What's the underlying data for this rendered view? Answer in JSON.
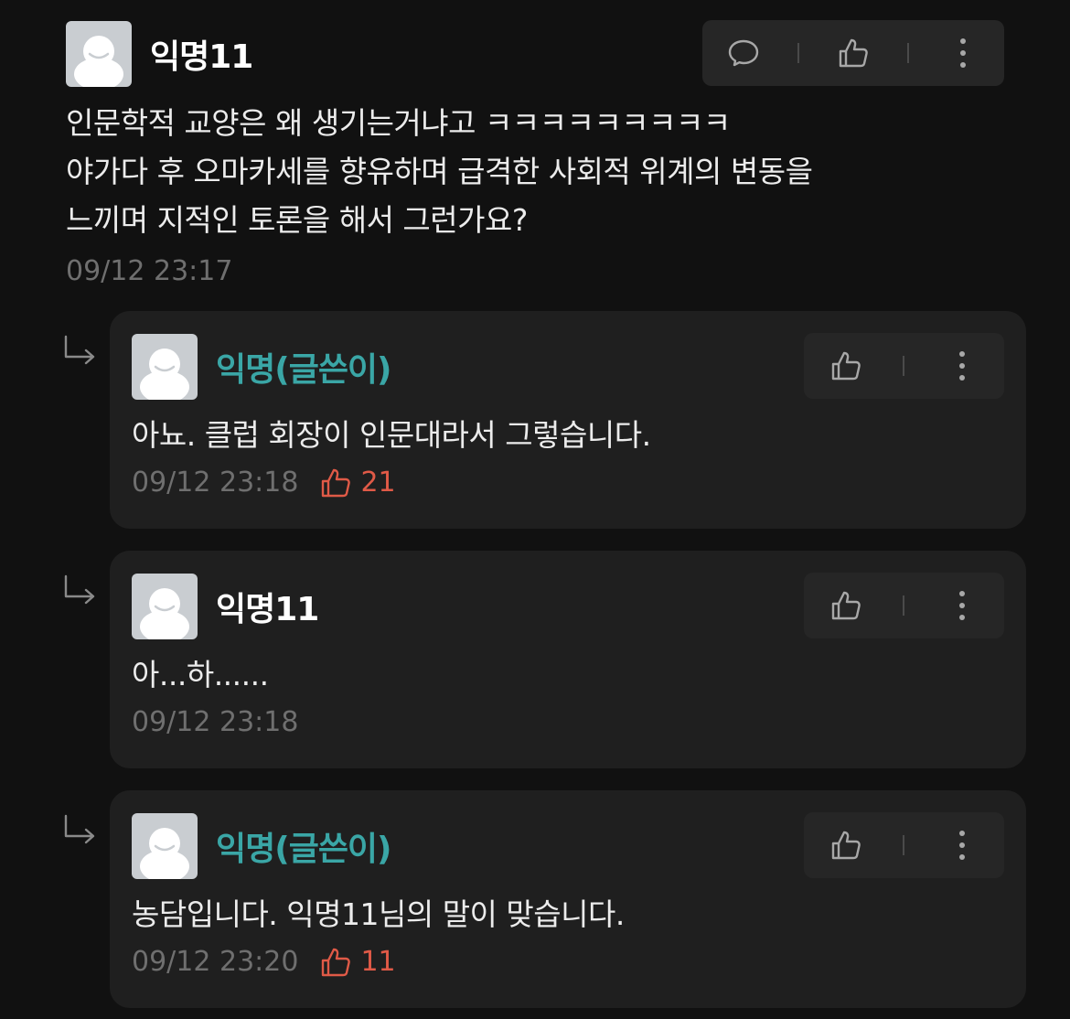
{
  "main": {
    "username": "익명11",
    "lines": [
      "인문학적 교양은 왜 생기는거냐고 ㅋㅋㅋㅋㅋㅋㅋㅋㅋ",
      "야가다 후 오마카세를 향유하며 급격한 사회적 위계의 변동을",
      "느끼며 지적인 토론을 해서 그런가요?"
    ],
    "timestamp": "09/12 23:17"
  },
  "replies": [
    {
      "username": "익명(글쓴이)",
      "is_author": true,
      "text": "아뇨. 클럽 회장이 인문대라서 그렇습니다.",
      "timestamp": "09/12 23:18",
      "likes": "21"
    },
    {
      "username": "익명11",
      "is_author": false,
      "text": "아...하......",
      "timestamp": "09/12 23:18",
      "likes": ""
    },
    {
      "username": "익명(글쓴이)",
      "is_author": true,
      "text": "농담입니다. 익명11님의 말이 맞습니다.",
      "timestamp": "09/12 23:20",
      "likes": "11"
    }
  ],
  "icons": {
    "comment": "speech-bubble-icon",
    "like": "thumbs-up-icon",
    "more": "vertical-dots-icon",
    "reply_arrow": "reply-arrow-icon"
  },
  "colors": {
    "background": "#111111",
    "reply_background": "#1f1f1f",
    "author_name": "#3aa6a6",
    "like_accent": "#e05a47",
    "timestamp": "#6f6f6f"
  }
}
